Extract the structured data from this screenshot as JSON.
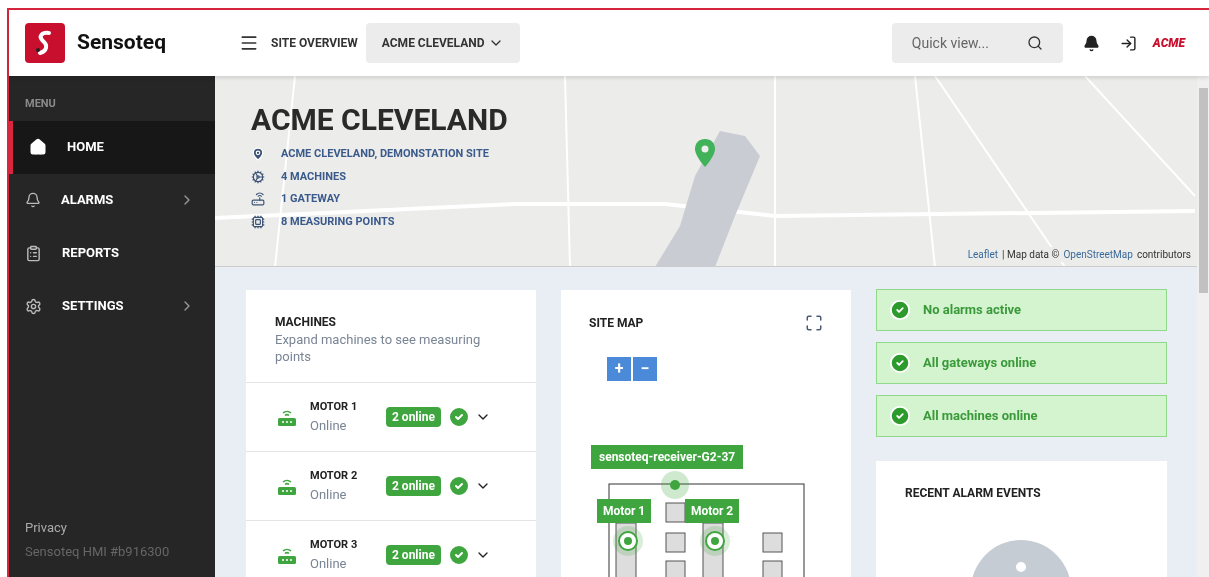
{
  "header": {
    "logo_text": "Sensoteq",
    "nav_label": "SITE OVERVIEW",
    "site_dropdown": "ACME CLEVELAND",
    "search": {
      "placeholder": "Quick view..."
    },
    "brand": "ACME"
  },
  "sidebar": {
    "menu_label": "MENU",
    "items": [
      {
        "label": "HOME",
        "kind": "home",
        "selected": true,
        "has_submenu": false
      },
      {
        "label": "ALARMS",
        "kind": "alarms",
        "selected": false,
        "has_submenu": true
      },
      {
        "label": "REPORTS",
        "kind": "reports",
        "selected": false,
        "has_submenu": false
      },
      {
        "label": "SETTINGS",
        "kind": "settings",
        "selected": false,
        "has_submenu": true
      }
    ],
    "footer": {
      "privacy": "Privacy",
      "version": "Sensoteq HMI #b916300"
    }
  },
  "site": {
    "title": "ACME CLEVELAND",
    "details": [
      {
        "kind": "location",
        "text": "ACME CLEVELAND, DEMONSTATION SITE"
      },
      {
        "kind": "machines",
        "text": "4 MACHINES"
      },
      {
        "kind": "gateway",
        "text": "1 GATEWAY"
      },
      {
        "kind": "points",
        "text": "8 MEASURING POINTS"
      }
    ],
    "attribution": {
      "leaflet": "Leaflet",
      "text": "| Map data ©",
      "osm": "OpenStreetMap",
      "suffix": "contributors"
    }
  },
  "machines": {
    "title": "MACHINES",
    "subtitle": "Expand machines to see measuring points",
    "rows": [
      {
        "name": "MOTOR 1",
        "status": "Online",
        "badge": "2 online"
      },
      {
        "name": "MOTOR 2",
        "status": "Online",
        "badge": "2 online"
      },
      {
        "name": "MOTOR 3",
        "status": "Online",
        "badge": "2 online"
      }
    ]
  },
  "site_map": {
    "title": "SITE MAP",
    "zoom_in": "+",
    "zoom_out": "−",
    "gateway_label": "sensoteq-receiver-G2-37",
    "motor_labels": [
      "Motor 1",
      "Motor 2"
    ]
  },
  "status_alerts": [
    {
      "text": "No alarms active"
    },
    {
      "text": "All gateways online"
    },
    {
      "text": "All machines online"
    }
  ],
  "recent_alarms": {
    "title": "RECENT ALARM EVENTS"
  }
}
